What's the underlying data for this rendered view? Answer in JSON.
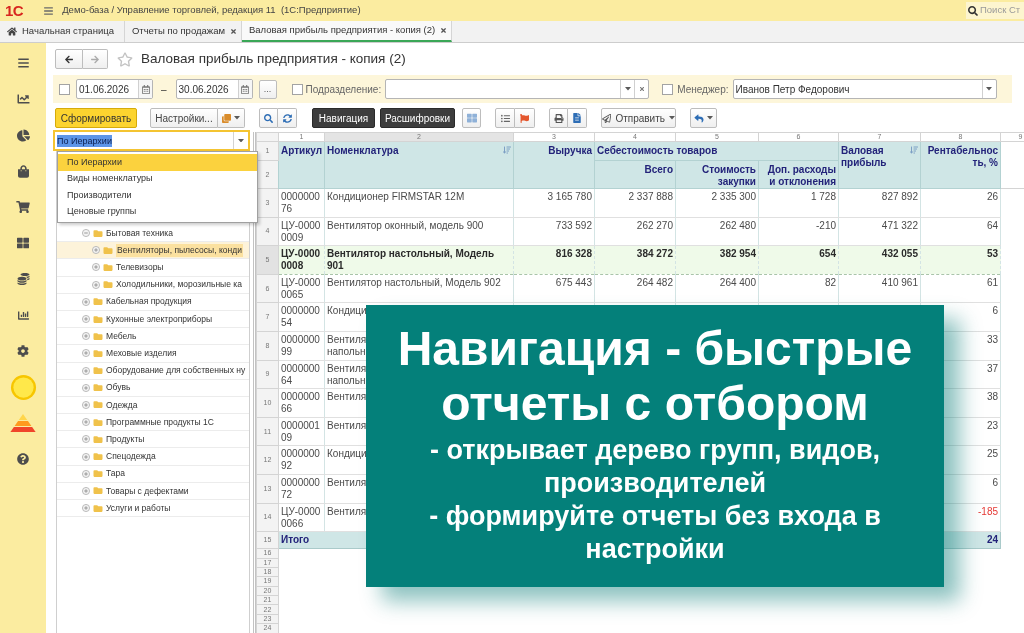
{
  "app": {
    "logo": "1С",
    "title": "Демо-база / Управление торговлей, редакция 11  (1С:Предприятие)",
    "search_placeholder": "Поиск Ст"
  },
  "tabs": [
    {
      "label": "Начальная страница",
      "kind": "home",
      "selected": false
    },
    {
      "label": "Отчеты по продажам",
      "kind": "document",
      "selected": false
    },
    {
      "label": "Валовая прибыль предприятия - копия (2)",
      "kind": "document",
      "selected": true
    }
  ],
  "report": {
    "title": "Валовая прибыль предприятия - копия (2)",
    "favorite": false
  },
  "filters": {
    "period": {
      "checked": false,
      "from": "01.06.2026",
      "separator": "–",
      "to": "30.06.2026",
      "choose_button": "..."
    },
    "department": {
      "checked": false,
      "label": "Подразделение:"
    },
    "manager": {
      "checked": false,
      "label": "Менеджер:",
      "value": "Иванов Петр Федорович"
    }
  },
  "toolbar": {
    "generate_button": "Сформировать",
    "settings_button": "Настройки...",
    "toggles": [
      {
        "label": "Навигация",
        "pressed": true
      },
      {
        "label": "Расшифровки",
        "pressed": true
      }
    ],
    "send_button": "Отправить"
  },
  "navigation": {
    "mode": {
      "value": "По Иерархии",
      "focused": true,
      "text_highlighted": true
    },
    "options": [
      {
        "label": "По Иерархии",
        "selected": true
      },
      {
        "label": "Виды номенклатуры",
        "selected": false
      },
      {
        "label": "Производители",
        "selected": false
      },
      {
        "label": "Ценовые группы",
        "selected": false
      }
    ],
    "tree": [
      {
        "label": "Бытовая техника",
        "expanded": true,
        "selected": false,
        "children": [
          {
            "label": "Вентиляторы, пылесосы, конди",
            "expanded": false,
            "selected": true
          },
          {
            "label": "Телевизоры",
            "expanded": false,
            "selected": false
          },
          {
            "label": "Холодильники, морозильные ка",
            "expanded": false,
            "selected": false
          }
        ]
      },
      {
        "label": "Кабельная продукция",
        "expanded": false,
        "selected": false
      },
      {
        "label": "Кухонные электроприборы",
        "expanded": false,
        "selected": false
      },
      {
        "label": "Мебель",
        "expanded": false,
        "selected": false
      },
      {
        "label": "Меховые изделия",
        "expanded": false,
        "selected": false
      },
      {
        "label": "Оборудование для собственных ну",
        "expanded": false,
        "selected": false
      },
      {
        "label": "Обувь",
        "expanded": false,
        "selected": false
      },
      {
        "label": "Одежда",
        "expanded": false,
        "selected": false
      },
      {
        "label": "Программные продукты 1С",
        "expanded": false,
        "selected": false
      },
      {
        "label": "Продукты",
        "expanded": false,
        "selected": false
      },
      {
        "label": "Спецодежда",
        "expanded": false,
        "selected": false
      },
      {
        "label": "Тара",
        "expanded": false,
        "selected": false
      },
      {
        "label": "Товары с дефектами",
        "expanded": false,
        "selected": false
      },
      {
        "label": "Услуги и работы",
        "expanded": false,
        "selected": false
      }
    ]
  },
  "table": {
    "column_numbers": [
      {
        "label": "1",
        "selected": false
      },
      {
        "label": "2",
        "selected": true
      },
      {
        "label": "3",
        "selected": false
      },
      {
        "label": "4",
        "selected": false
      },
      {
        "label": "5",
        "selected": false
      },
      {
        "label": "6",
        "selected": false
      },
      {
        "label": "7",
        "selected": false
      },
      {
        "label": "8",
        "selected": false
      },
      {
        "label": "9",
        "selected": false
      }
    ],
    "header_row_numbers": [
      "1",
      "2"
    ],
    "header": {
      "article": {
        "label": "Артикул",
        "sorted": false
      },
      "product": {
        "label": "Номенклатура",
        "sorted": true
      },
      "revenue": {
        "label": "Выручка",
        "sorted": false
      },
      "cost_group": {
        "label": "Себестоимость товаров"
      },
      "cost_total": {
        "label": "Всего",
        "sorted": false
      },
      "purchase_cost": {
        "label": "Стоимость закупки",
        "sorted": false
      },
      "extra_costs": {
        "label": "Доп. расходы и отклонения",
        "sorted": false
      },
      "gross_profit": {
        "label": "Валовая прибыль",
        "sorted": true
      },
      "profitability": {
        "label": "Рентабельность, %",
        "sorted": false
      }
    },
    "rows": [
      {
        "number": "3",
        "article": "000000076",
        "product": "Кондиционер FIRMSTAR 12M",
        "revenue": "3 165 780",
        "cost_total": "2 337 888",
        "purchase_cost": "2 335 300",
        "extra_costs": "1 728",
        "gross_profit": "827 892",
        "profitability": "26",
        "selected": false,
        "profitability_alert": false
      },
      {
        "number": "4",
        "article": "ЦУ-00000009",
        "product": "Вентилятор оконный, модель 900",
        "revenue": "733 592",
        "cost_total": "262 270",
        "purchase_cost": "262 480",
        "extra_costs": "-210",
        "gross_profit": "471 322",
        "profitability": "64",
        "selected": false,
        "profitability_alert": false
      },
      {
        "number": "5",
        "article": "ЦУ-00000008",
        "product": "Вентилятор настольный, Модель 901",
        "revenue": "816 328",
        "cost_total": "384 272",
        "purchase_cost": "382 954",
        "extra_costs": "654",
        "gross_profit": "432 055",
        "profitability": "53",
        "selected": true,
        "profitability_alert": false
      },
      {
        "number": "6",
        "article": "ЦУ-00000065",
        "product": "Вентилятор настольный, Модель 902",
        "revenue": "675 443",
        "cost_total": "264 482",
        "purchase_cost": "264 400",
        "extra_costs": "82",
        "gross_profit": "410 961",
        "profitability": "61",
        "selected": false,
        "profitability_alert": false
      },
      {
        "number": "7",
        "article": "000000054",
        "product": "Кондици",
        "profitability": "6",
        "selected": false,
        "profitability_alert": false
      },
      {
        "number": "8",
        "article": "000000099",
        "product": "Вентиля напольн",
        "profitability": "33",
        "selected": false,
        "profitability_alert": false
      },
      {
        "number": "9",
        "article": "000000064",
        "product": "Вентиля напольн",
        "profitability": "37",
        "selected": false,
        "profitability_alert": false
      },
      {
        "number": "10",
        "article": "000000066",
        "product": "Вентиля",
        "profitability": "38",
        "selected": false,
        "profitability_alert": false
      },
      {
        "number": "11",
        "article": "000000109",
        "product": "Вентиля",
        "profitability": "23",
        "selected": false,
        "profitability_alert": false
      },
      {
        "number": "12",
        "article": "000000092",
        "product": "Кондици",
        "profitability": "25",
        "selected": false,
        "profitability_alert": false
      },
      {
        "number": "13",
        "article": "000000072",
        "product": "Вентиля",
        "profitability": "6",
        "selected": false,
        "profitability_alert": false
      },
      {
        "number": "14",
        "article": "ЦУ-00000066",
        "product": "Вентиля",
        "profitability": "-185",
        "selected": false,
        "profitability_alert": true
      }
    ],
    "total": {
      "number": "15",
      "label": "Итого",
      "profitability": "24"
    },
    "empty_row_numbers": [
      "16",
      "17",
      "18",
      "19",
      "20",
      "21",
      "22",
      "23",
      "24"
    ]
  },
  "callout": {
    "title": "Навигация - быстрые отчеты с отбором",
    "points": [
      "- открывает дерево групп, видов, производителей",
      "- формируйте отчеты без входа в настройки"
    ]
  }
}
